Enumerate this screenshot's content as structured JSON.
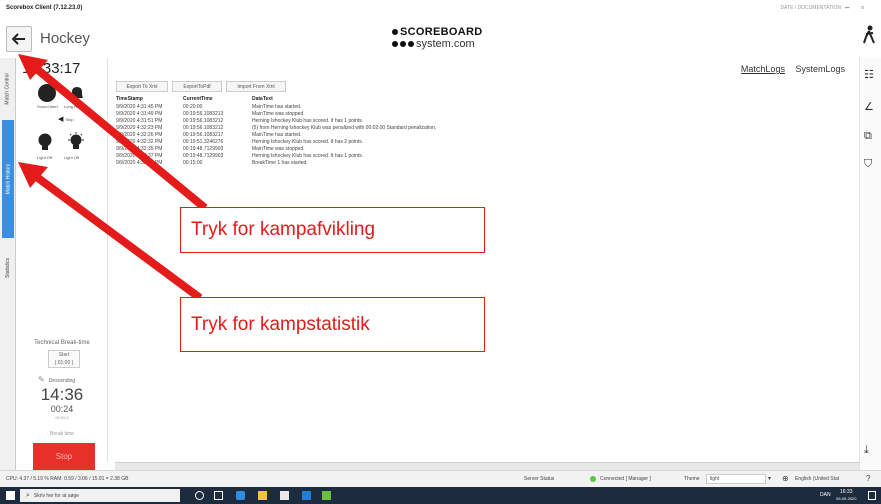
{
  "window": {
    "title": "Scorebox Client (7.12.23.0)",
    "top_right_text": "DATE / DOCUMENTATION",
    "minimize": "–",
    "maximize": "▫"
  },
  "header": {
    "sport": "Hockey",
    "logo_line1": "SCOREBOARD",
    "logo_line2": "system.com"
  },
  "left_tabs": [
    "Match Control",
    "Match History",
    "Statistics"
  ],
  "panel": {
    "clock": "16:33:17",
    "btn_label_1": "Sound Alert",
    "btn_label_2": "Long Horn",
    "btn_label_3": "Stop",
    "btn_label_4": "Light Off",
    "btn_label_5": "Light Off",
    "break_title": "Technical Break-time",
    "start_label": "Start",
    "start_time": "[ 01:00 ]",
    "descending": "Descending",
    "big_time": "14:36",
    "sub_time": "00:24",
    "sub_small": "00:00.0",
    "break_time_label": "Break time",
    "stop_label": "Stop"
  },
  "toolbar": {
    "export_xml": "Export To Xml",
    "export_pdf": "ExportToPdf",
    "import_xml": "Import From Xml"
  },
  "log_tabs": [
    "MatchLogs",
    "SystemLogs"
  ],
  "log": {
    "headers": [
      "TimeStamp",
      "CurrentTime",
      "DataText"
    ],
    "rows": [
      [
        "9/9/2020 4:31:45 PM",
        "00:20:00",
        "MainTime has started."
      ],
      [
        "9/9/2020 4:31:49 PM",
        "00:19:56.1083213",
        "MainTime was stopped."
      ],
      [
        "9/9/2020 4:31:51 PM",
        "00:19:56.1083212",
        "Herning Ishockey Klub has scored. It has 1 points."
      ],
      [
        "9/9/2020 4:32:23 PM",
        "00:19:56.1083212",
        "(5) from Herning Ishockey Klub was penalized with 00:02:00 Standard penalization."
      ],
      [
        "9/9/2020 4:32:26 PM",
        "00:19:56.1083217",
        "MainTime has started."
      ],
      [
        "9/9/2020 4:32:32 PM",
        "00:19:51.3246276",
        "Herning Ishockey Klub has scored. It has 2 points."
      ],
      [
        "9/9/2020 4:32:35 PM",
        "00:19:48.7129903",
        "MainTime was stopped."
      ],
      [
        "9/9/2020 4:32:37 PM",
        "00:19:48.7129903",
        "Herning Ishockey Klub has scored. It has 1 points."
      ],
      [
        "9/9/2020 4:33:00 PM",
        "00:15:00",
        "BreakTime 1 has started."
      ]
    ]
  },
  "status": {
    "cpu": "CPU: 4.37 / 5.19 % RAM: 0.59 / 3.06 / 15.91 = 2.38 GB",
    "server_status": "Server Status",
    "connected": "Connected [ Manager ]",
    "theme_label": "Theme",
    "theme_value": "light",
    "language": "English (United Stat"
  },
  "taskbar": {
    "search_placeholder": "Skriv her for at søge",
    "lang": "DAN",
    "time": "16:33",
    "date": "09-09-2020"
  },
  "annotations": {
    "callout_1": "Tryk for kampafvikling",
    "callout_2": "Tryk for kampstatistik"
  },
  "colors": {
    "accent_tab": "#3b8fe0",
    "stop_button": "#e8302a",
    "annotation": "#e31b1b",
    "connected": "#5cc64a"
  }
}
